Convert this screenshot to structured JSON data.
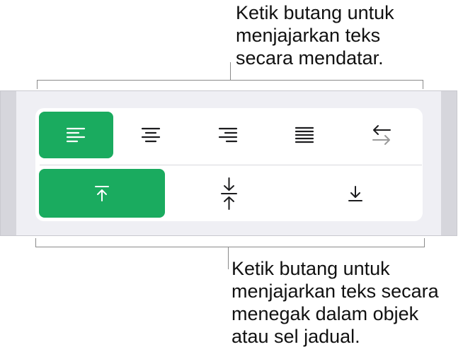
{
  "callouts": {
    "horizontal": "Ketik butang untuk\nmenjajarkan teks\nsecara mendatar.",
    "vertical": "Ketik butang untuk\nmenjajarkan teks secara\nmenegak dalam objek\natau sel jadual."
  },
  "colors": {
    "selected": "#1aab5f",
    "icon_default": "#1c1c1e",
    "icon_selected": "#ffffff",
    "icon_auto_secondary": "#9a9a9a",
    "panel_background": "#efeff4"
  },
  "horizontal_alignment": {
    "buttons": [
      {
        "icon": "align-left-icon",
        "selected": true
      },
      {
        "icon": "align-center-icon",
        "selected": false
      },
      {
        "icon": "align-right-icon",
        "selected": false
      },
      {
        "icon": "align-justify-icon",
        "selected": false
      },
      {
        "icon": "auto-align-icon",
        "selected": false
      }
    ]
  },
  "vertical_alignment": {
    "buttons": [
      {
        "icon": "align-top-icon",
        "selected": true
      },
      {
        "icon": "align-middle-icon",
        "selected": false
      },
      {
        "icon": "align-bottom-icon",
        "selected": false
      }
    ]
  }
}
